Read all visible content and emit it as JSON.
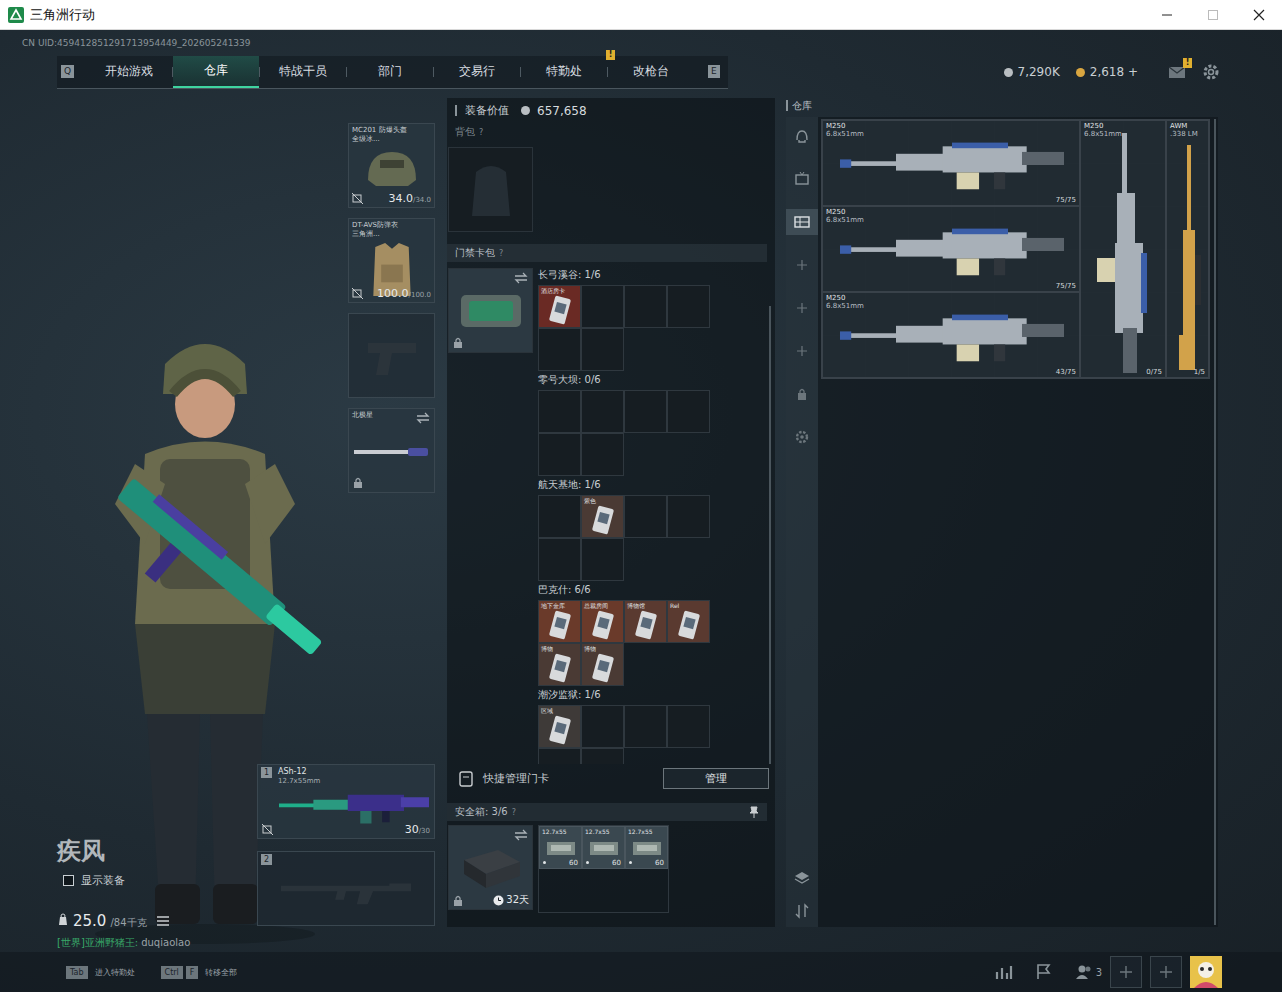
{
  "window": {
    "title": "三角洲行动"
  },
  "uid": "CN UID:459412851291713954449_202605241339",
  "nav": {
    "prev_key": "Q",
    "next_key": "E",
    "tabs": [
      {
        "label": "开始游戏",
        "selected": false,
        "badge": ""
      },
      {
        "label": "仓库",
        "selected": true,
        "badge": ""
      },
      {
        "label": "特战干员",
        "selected": false,
        "badge": ""
      },
      {
        "label": "部门",
        "selected": false,
        "badge": ""
      },
      {
        "label": "交易行",
        "selected": false,
        "badge": ""
      },
      {
        "label": "特勤处",
        "selected": false,
        "badge": "!"
      },
      {
        "label": "改枪台",
        "selected": false,
        "badge": ""
      }
    ]
  },
  "currency": [
    {
      "value": "7,290K",
      "color": "#b9bec2"
    },
    {
      "value": "2,618 +",
      "color": "#d9a640"
    }
  ],
  "mail_badge": "!",
  "gear_slots": [
    {
      "kind": "gear",
      "title": "MC201 防爆头盔",
      "subtitle": "全级冰...",
      "value": "34.0",
      "max": "/34.0",
      "locked": false,
      "swap": false
    },
    {
      "kind": "gear",
      "title": "DT-AVS防弹衣",
      "subtitle": "三角洲...",
      "value": "100.0",
      "max": "/100.0",
      "locked": false,
      "swap": false
    },
    {
      "kind": "empty",
      "title": "",
      "subtitle": "",
      "value": "",
      "max": "",
      "locked": false,
      "swap": false
    },
    {
      "kind": "melee",
      "title": "北极星",
      "subtitle": "",
      "value": "",
      "max": "",
      "locked": true,
      "swap": true
    }
  ],
  "weapon_slots": [
    {
      "slot": "1",
      "filled": true,
      "name": "ASh-12",
      "caliber": "12.7x55mm",
      "ammo": "30",
      "max": "/30"
    },
    {
      "slot": "2",
      "filled": false,
      "name": "",
      "caliber": "",
      "ammo": "",
      "max": ""
    }
  ],
  "operator": {
    "name": "疾风",
    "show_gear_label": "显示装备",
    "show_gear": false,
    "weight": "25.0",
    "weight_max": "/84千克"
  },
  "chat": {
    "channel": "[世界]",
    "sender": "亚洲野猪王",
    "separator": ":",
    "message": "duqiaolao"
  },
  "loadout": {
    "value_label": "装备价值",
    "value": "657,658",
    "backpack_label": "背包",
    "backpack_help": "?",
    "keycard_label": "门禁卡包",
    "keycard_help": "?",
    "keycard_groups": [
      {
        "label": "长弓溪谷: 1/6",
        "slots": [
          {
            "filled": true,
            "label": "酒店房卡",
            "color": "#6a2a24"
          },
          {
            "filled": false,
            "label": "",
            "color": ""
          },
          {
            "filled": false,
            "label": "",
            "color": ""
          },
          {
            "filled": false,
            "label": "",
            "color": ""
          },
          {
            "filled": false,
            "label": "",
            "color": ""
          },
          {
            "filled": false,
            "label": "",
            "color": ""
          }
        ]
      },
      {
        "label": "零号大坝: 0/6",
        "slots": [
          {
            "filled": false,
            "label": "",
            "color": ""
          },
          {
            "filled": false,
            "label": "",
            "color": ""
          },
          {
            "filled": false,
            "label": "",
            "color": ""
          },
          {
            "filled": false,
            "label": "",
            "color": ""
          },
          {
            "filled": false,
            "label": "",
            "color": ""
          },
          {
            "filled": false,
            "label": "",
            "color": ""
          }
        ]
      },
      {
        "label": "航天基地: 1/6",
        "slots": [
          {
            "filled": false,
            "label": "",
            "color": ""
          },
          {
            "filled": true,
            "label": "紫色",
            "color": "#4a3a34"
          },
          {
            "filled": false,
            "label": "",
            "color": ""
          },
          {
            "filled": false,
            "label": "",
            "color": ""
          },
          {
            "filled": false,
            "label": "",
            "color": ""
          },
          {
            "filled": false,
            "label": "",
            "color": ""
          }
        ]
      },
      {
        "label": "巴克什: 6/6",
        "slots": [
          {
            "filled": true,
            "label": "地下金库",
            "color": "#6a3a2a"
          },
          {
            "filled": true,
            "label": "总裁房间",
            "color": "#6a3a2a"
          },
          {
            "filled": true,
            "label": "博物馆",
            "color": "#5a3a30"
          },
          {
            "filled": true,
            "label": "Rel",
            "color": "#5a3a30"
          },
          {
            "filled": true,
            "label": "博物",
            "color": "#4a3a34"
          },
          {
            "filled": true,
            "label": "博物",
            "color": "#4a3a34"
          }
        ]
      },
      {
        "label": "潮汐监狱: 1/6",
        "slots": [
          {
            "filled": true,
            "label": "区域",
            "color": "#3e3a38"
          },
          {
            "filled": false,
            "label": "",
            "color": ""
          },
          {
            "filled": false,
            "label": "",
            "color": ""
          },
          {
            "filled": false,
            "label": "",
            "color": ""
          },
          {
            "filled": false,
            "label": "",
            "color": ""
          },
          {
            "filled": false,
            "label": "",
            "color": ""
          }
        ]
      }
    ],
    "quick_manage": {
      "label": "快捷管理门卡",
      "button": "管理"
    },
    "safe": {
      "label": "安全箱: 3/6",
      "help": "?",
      "timer": "32天",
      "items": [
        {
          "name": "12.7x55",
          "count": "60"
        },
        {
          "name": "12.7x55",
          "count": "60"
        },
        {
          "name": "12.7x55",
          "count": "60"
        }
      ]
    }
  },
  "storage": {
    "title": "仓库",
    "sidebar": [
      {
        "selected": false
      },
      {
        "selected": false
      },
      {
        "selected": true
      },
      {
        "selected": false
      },
      {
        "selected": false
      },
      {
        "selected": false
      },
      {
        "selected": false
      },
      {
        "selected": false
      }
    ],
    "items": [
      {
        "kind": "horizontal",
        "name": "M250",
        "caliber": "6.8x51mm",
        "ammo": "75/75",
        "color": "#a8b0b8"
      },
      {
        "kind": "vertical",
        "name": "M250",
        "caliber": "6.8x51mm",
        "ammo": "0/75",
        "color": "#a8b0b8"
      },
      {
        "kind": "slim",
        "name": "AWM",
        "caliber": ".338 LM",
        "ammo": "1/5",
        "color": "#d2a24a"
      },
      {
        "kind": "horizontal",
        "name": "M250",
        "caliber": "6.8x51mm",
        "ammo": "75/75",
        "color": "#a8b0b8"
      },
      {
        "kind": "horizontal",
        "name": "M250",
        "caliber": "6.8x51mm",
        "ammo": "43/75",
        "color": "#a8b0b8"
      }
    ]
  },
  "hints": [
    {
      "keys": [
        "Tab"
      ],
      "label": "进入特勤处"
    },
    {
      "keys": [
        "Ctrl",
        "F"
      ],
      "label": "转移全部"
    }
  ],
  "friends_count": "3"
}
